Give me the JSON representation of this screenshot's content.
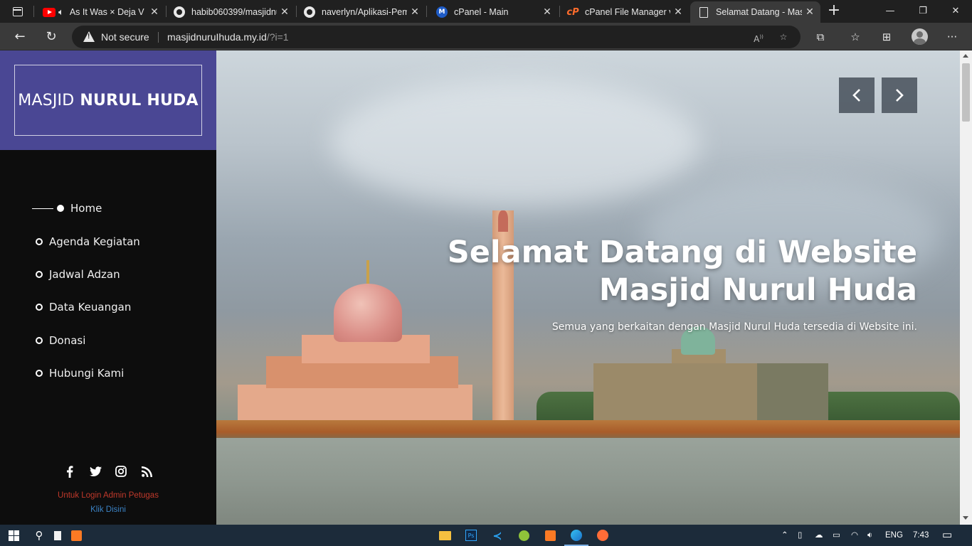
{
  "browser": {
    "tabs": [
      {
        "title": "As It Was × Deja V",
        "icon": "youtube-icon",
        "active": false
      },
      {
        "title": "habib060399/masjidnu",
        "icon": "github-icon",
        "active": false
      },
      {
        "title": "naverlyn/Aplikasi-Pem",
        "icon": "github-icon",
        "active": false
      },
      {
        "title": "cPanel - Main",
        "icon": "cpanel-m-icon",
        "active": false
      },
      {
        "title": "cPanel File Manager v3",
        "icon": "cpanel-icon",
        "active": false
      },
      {
        "title": "Selamat Datang - Mas",
        "icon": "document-icon",
        "active": true
      }
    ],
    "security_label": "Not secure",
    "url_host": "masjidnuruIhuda.my.id",
    "url_path": "/?i=1",
    "window_buttons": [
      "minimize",
      "restore",
      "close"
    ]
  },
  "site": {
    "brand_light": "MASJID",
    "brand_bold": "NURUL HUDA",
    "nav": [
      {
        "label": "Home",
        "active": true
      },
      {
        "label": "Agenda Kegiatan",
        "active": false
      },
      {
        "label": "Jadwal Adzan",
        "active": false
      },
      {
        "label": "Data Keuangan",
        "active": false
      },
      {
        "label": "Donasi",
        "active": false
      },
      {
        "label": "Hubungi Kami",
        "active": false
      }
    ],
    "social_icons": [
      "facebook-icon",
      "twitter-icon",
      "instagram-icon",
      "rss-icon"
    ],
    "login_note": "Untuk Login Admin Petugas",
    "login_link": "Klik Disini"
  },
  "hero": {
    "title_line1": "Selamat Datang di Website",
    "title_line2": "Masjid Nurul Huda",
    "subtitle": "Semua yang berkaitan dengan Masjid Nurul Huda tersedia di Website ini."
  },
  "taskbar": {
    "language": "ENG",
    "time": "7:43"
  },
  "colors": {
    "brand_block": "#4a4794",
    "sidebar_bg": "#0d0d0d",
    "login_note": "#c0392b",
    "login_link": "#3b82c4"
  }
}
